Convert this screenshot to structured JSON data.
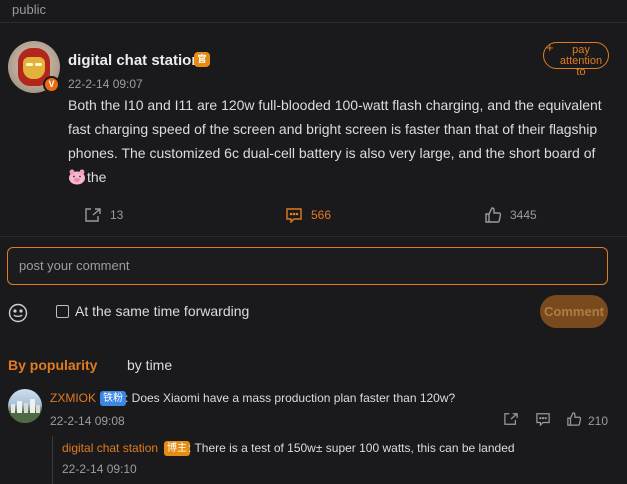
{
  "section": {
    "label": "public"
  },
  "post": {
    "username": "digital chat station",
    "crown_badge": "官",
    "verified_badge": "V",
    "time": "22-2-14 09:07",
    "body": "Both the I10 and I11 are 120w full-blooded 100-watt flash charging, and the equivalent fast charging speed of the screen and bright screen is faster than that of their flagship phones. The customized 6c dual-cell battery is also very large, and the short board of ",
    "body_tail": "the",
    "follow_button": "pay attention to",
    "follow_plus": "+",
    "shares": "13",
    "comments": "566",
    "likes": "3445"
  },
  "composer": {
    "placeholder": "post your comment",
    "forward_label": "At the same time forwarding",
    "submit_label": "Comment"
  },
  "sort": {
    "popularity": "By popularity",
    "time": "by time"
  },
  "comments": [
    {
      "name": "ZXMIOK",
      "badge": "铁粉",
      "text": ": Does Xiaomi have a mass production plan faster than 120w?",
      "time": "22-2-14 09:08",
      "likes": "210",
      "reply": {
        "name": "digital chat station",
        "badge": "博主",
        "text": ": There is a test of 150w± super 100 watts, this can be landed",
        "time": "22-2-14 09:10"
      }
    }
  ],
  "colors": {
    "accent": "#e07b1f",
    "background": "#1a1a1d",
    "fan_badge": "#3d86e3"
  },
  "icons": [
    "share-icon",
    "comment-icon",
    "like-icon",
    "emoji-icon",
    "crown-icon",
    "pig-emoji-icon"
  ]
}
